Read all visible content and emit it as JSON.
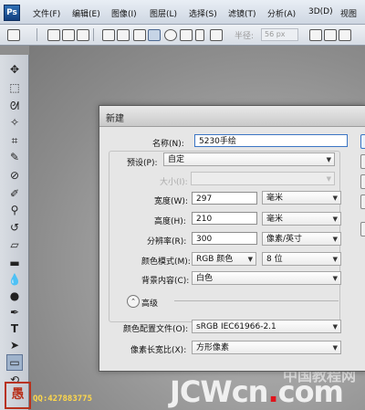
{
  "app": {
    "logo": "Ps"
  },
  "menu": [
    "文件(F)",
    "编辑(E)",
    "图像(I)",
    "图层(L)",
    "选择(S)",
    "滤镜(T)",
    "分析(A)",
    "3D(D)",
    "视图"
  ],
  "options_bar": {
    "feather_label": "半径:",
    "feather_value": "56 px"
  },
  "dialog": {
    "title": "新建",
    "name_label": "名称(N):",
    "name_value": "5230手绘",
    "preset_label": "预设(P):",
    "preset_value": "自定",
    "size_label": "大小(I):",
    "size_value": "",
    "width_label": "宽度(W):",
    "width_value": "297",
    "width_unit": "毫米",
    "height_label": "高度(H):",
    "height_value": "210",
    "height_unit": "毫米",
    "resolution_label": "分辨率(R):",
    "resolution_value": "300",
    "resolution_unit": "像素/英寸",
    "color_mode_label": "颜色模式(M):",
    "color_mode_value": "RGB 颜色",
    "bit_depth_value": "8 位",
    "background_label": "背景内容(C):",
    "background_value": "白色",
    "advanced_label": "高级",
    "profile_label": "颜色配置文件(O):",
    "profile_value": "sRGB IEC61966-2.1",
    "aspect_label": "像素长宽比(X):",
    "aspect_value": "方形像素"
  },
  "watermark": {
    "site_cn": "中国教程网",
    "site_en_a": "JCWcn",
    "site_en_dot": ".",
    "site_en_b": "com",
    "qq": "QQ:427883775",
    "seal": "愚"
  },
  "colors": {
    "accent": "#3b75c4",
    "watermark_dot": "#e0141c",
    "qq_text": "#ffd84a"
  }
}
